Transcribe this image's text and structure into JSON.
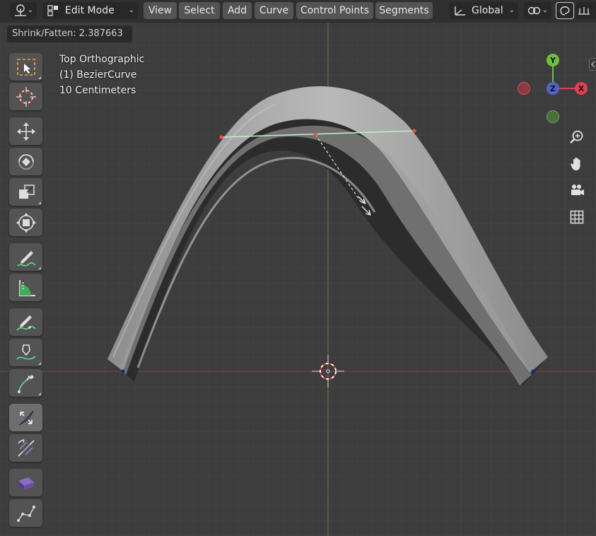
{
  "header": {
    "mode_label": "Edit Mode",
    "menus": [
      "View",
      "Select",
      "Add",
      "Curve",
      "Control Points",
      "Segments"
    ],
    "transform_orientation": "Global"
  },
  "status": {
    "operation": "Shrink/Fatten: 2.387663"
  },
  "viewport": {
    "view_name": "Top Orthographic",
    "object_name": "(1) BezierCurve",
    "grid_scale": "10 Centimeters"
  },
  "gizmo": {
    "y_label": "Y",
    "x_label": "X",
    "z_label": "Z"
  },
  "colors": {
    "x_axis": "#e0404f",
    "y_axis": "#6fbf3e",
    "z_axis": "#4f66c8",
    "selected_point": "#ff4a2a",
    "unselected_point": "#1b1bb0",
    "active_segment": "#b8f0c6"
  },
  "tools": [
    "select-box-icon",
    "cursor-icon",
    "move-icon",
    "rotate-icon",
    "scale-icon",
    "transform-icon",
    "annotate-icon",
    "measure-icon",
    "draw-icon",
    "pen-icon",
    "extrude-curve-icon",
    "radius-icon",
    "tilt-icon",
    "randomize-icon",
    "vertex-icon"
  ]
}
